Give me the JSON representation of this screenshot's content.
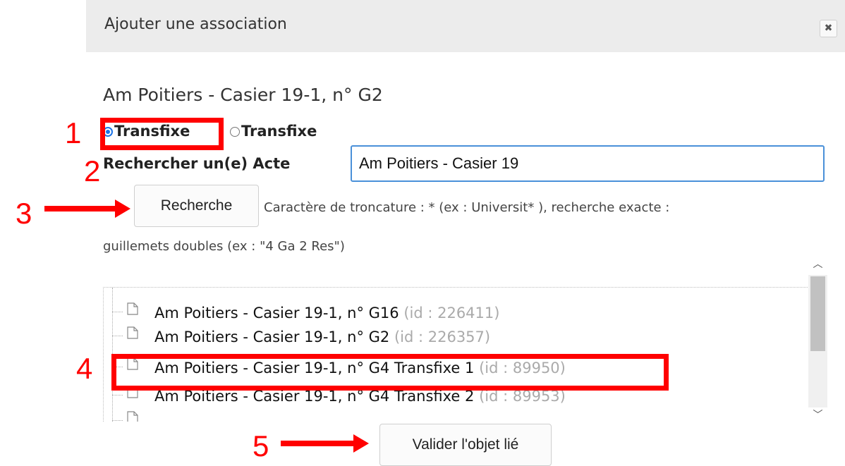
{
  "dialog": {
    "title": "Ajouter une association",
    "close_label": "✖",
    "record_title": "Am Poitiers - Casier 19-1, n° G2"
  },
  "radios": [
    {
      "label": "Transfixe",
      "checked": true
    },
    {
      "label": "Transfixe",
      "checked": false
    }
  ],
  "search": {
    "label": "Rechercher un(e) Acte",
    "value": "Am Poitiers - Casier 19",
    "button_label": "Recherche",
    "help_line1": "Caractère de troncature : * (ex : Universit* ), recherche exacte :",
    "help_line2": "guillemets doubles (ex : \"4 Ga 2 Res\")"
  },
  "tree": {
    "items": [
      {
        "label": "Am Poitiers - Casier 19-1, n° G16",
        "id": "(id : 226411)"
      },
      {
        "label": "Am Poitiers - Casier 19-1, n° G2",
        "id": "(id : 226357)"
      },
      {
        "label": "Am Poitiers - Casier 19-1, n° G4 Transfixe 1",
        "id": "(id : 89950)"
      },
      {
        "label": "Am Poitiers - Casier 19-1, n° G4 Transfixe 2",
        "id": "(id : 89953)"
      }
    ]
  },
  "validate": {
    "label": "Valider l'objet lié"
  },
  "annotations": {
    "n1": "1",
    "n2": "2",
    "n3": "3",
    "n4": "4",
    "n5": "5",
    "color": "#ff0000"
  },
  "icons": {
    "close": "close-icon",
    "document": "document-icon",
    "scroll_up": "chevron-up-icon",
    "scroll_down": "chevron-down-icon"
  }
}
